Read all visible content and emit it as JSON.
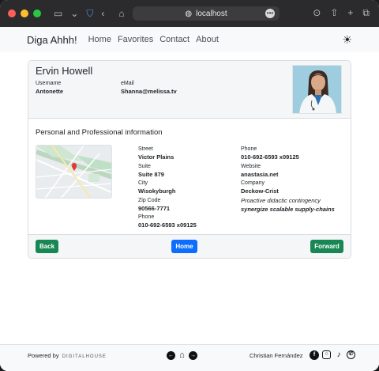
{
  "browser": {
    "url": "localhost"
  },
  "navbar": {
    "brand": "Diga Ahhh!",
    "links": [
      "Home",
      "Favorites",
      "Contact",
      "About"
    ],
    "theme_icon": "sun-icon"
  },
  "user": {
    "name": "Ervin Howell",
    "username_label": "Username",
    "username": "Antonette",
    "email_label": "eMail",
    "email": "Shanna@melissa.tv"
  },
  "info": {
    "section_title": "Personal and Professional information",
    "street_label": "Street",
    "street": "Victor Plains",
    "suite_label": "Suite",
    "suite": "Suite 879",
    "city_label": "City",
    "city": "Wisokyburgh",
    "zip_label": "Zip Code",
    "zip": "90566-7771",
    "phone_label": "Phone",
    "phone": "010-692-6593 x09125",
    "phone2_label": "Phone",
    "phone2": "010-692-6593 x09125",
    "website_label": "Website",
    "website": "anastasia.net",
    "company_label": "Company",
    "company": "Deckow-Crist",
    "catch_phrase": "Proactive didactic contingency",
    "bs": "synergize scalable supply-chains"
  },
  "buttons": {
    "back": "Back",
    "home": "Home",
    "forward": "Forward"
  },
  "footer": {
    "powered_by": "Powered by",
    "powered_brand": "DIGITALHOUSE",
    "author": "Christian Fernández",
    "socials": [
      "facebook-icon",
      "instagram-icon",
      "tiktok-icon",
      "whatsapp-icon"
    ]
  },
  "colors": {
    "success": "#198754",
    "primary": "#0d6efd"
  }
}
